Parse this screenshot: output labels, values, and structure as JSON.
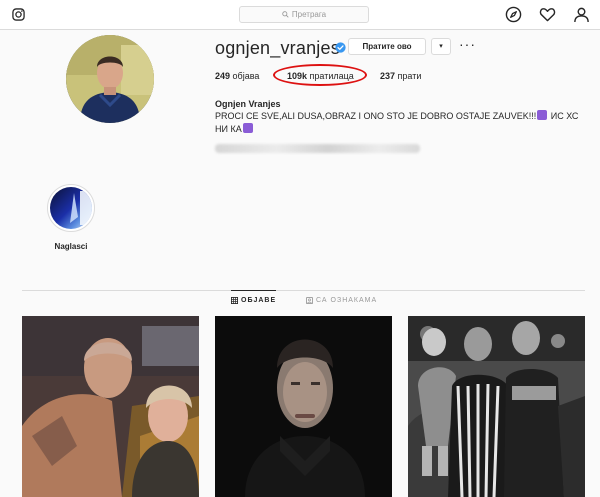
{
  "header": {
    "logo_icon": "instagram-icon",
    "search_placeholder": "Претрага",
    "nav_icons": [
      "compass-icon",
      "heart-icon",
      "person-icon"
    ]
  },
  "profile": {
    "username": "ognjen_vranjes",
    "verified": true,
    "follow_label": "Пратите ово",
    "dropdown_label": "▾",
    "more_label": "···",
    "stats": {
      "posts_count": "249",
      "posts_label": "објава",
      "followers_count": "109k",
      "followers_label": "пратилаца",
      "following_count": "237",
      "following_label": "прати"
    },
    "full_name": "Ognjen Vranjes",
    "bio_line1": "PROCI CE SVE,ALI DUSA,OBRAZ I ONO STO JE DOBRO OSTAJE ZAUVEK!!!",
    "bio_line1_end": "ИС ХС",
    "bio_line2": "НИ КА"
  },
  "highlights": [
    {
      "label": "Naglasci"
    }
  ],
  "tabs": {
    "posts_label": "ОБЈАВЕ",
    "tagged_label": "СА ОЗНАКАМА"
  },
  "colors": {
    "accent": "#3897f0",
    "annotation_ring": "#dd1111",
    "emoji_purple": "#8a5cd6"
  }
}
